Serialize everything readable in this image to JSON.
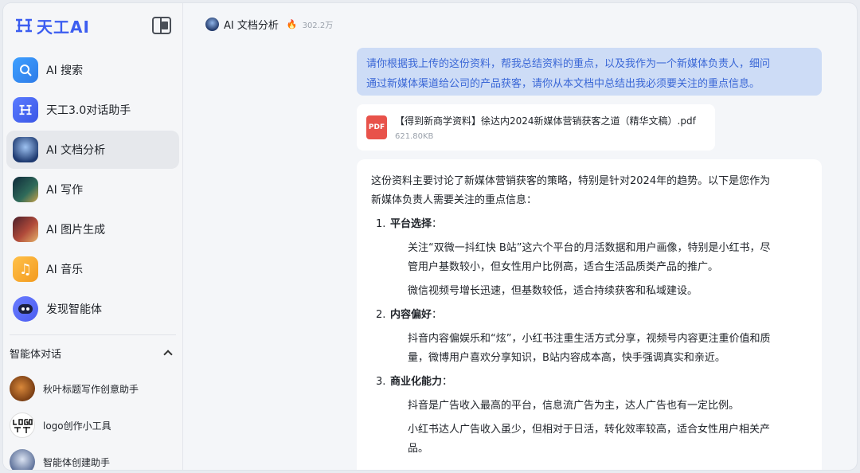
{
  "app": {
    "logo_text": "天工AI"
  },
  "nav": [
    {
      "label": "AI 搜索",
      "icon": "search-icon"
    },
    {
      "label": "天工3.0对话助手",
      "icon": "tiangong-logo-icon"
    },
    {
      "label": "AI 文档分析",
      "icon": "robot-doc-icon",
      "active": true
    },
    {
      "label": "AI 写作",
      "icon": "writing-icon"
    },
    {
      "label": "AI 图片生成",
      "icon": "dragon-image-icon"
    },
    {
      "label": "AI 音乐",
      "icon": "music-note-icon"
    },
    {
      "label": "发现智能体",
      "icon": "agent-bot-icon"
    }
  ],
  "agents_section": {
    "title": "智能体对话"
  },
  "agents": [
    {
      "label": "秋叶标题写作创意助手"
    },
    {
      "label": "logo创作小工具"
    },
    {
      "label": "智能体创建助手"
    }
  ],
  "topbar": {
    "title": "AI 文档分析",
    "count": "302.2万"
  },
  "chat": {
    "user_message_line1": "请你根据我上传的这份资料，帮我总结资料的重点，以及我作为一个新媒体负责人，细问",
    "user_message_line2": "通过新媒体渠道给公司的产品获客，请你从本文档中总结出我必须要关注的重点信息。",
    "file": {
      "icon_text": "PDF",
      "name": "【得到新商学资料】徐达内2024新媒体营销获客之道（精华文稿）.pdf",
      "size": "621.80KB"
    },
    "answer": {
      "intro_line1": "这份资料主要讨论了新媒体营销获客的策略，特别是针对2024年的趋势。以下是您作为",
      "intro_line2": "新媒体负责人需要关注的重点信息：",
      "items": [
        {
          "num": "1.",
          "title": "平台选择",
          "points": [
            [
              "关注“双微一抖红快 B站”这六个平台的月活数据和用户画像，特别是小红书，尽",
              "管用户基数较小，但女性用户比例高，适合生活品质类产品的推广。"
            ],
            [
              "微信视频号增长迅速，但基数较低，适合持续获客和私域建设。"
            ]
          ]
        },
        {
          "num": "2.",
          "title": "内容偏好",
          "points": [
            [
              "抖音内容偏娱乐和“炫”，小红书注重生活方式分享，视频号内容更注重价值和质",
              "量，微博用户喜欢分享知识，B站内容成本高，快手强调真实和亲近。"
            ]
          ]
        },
        {
          "num": "3.",
          "title": "商业化能力",
          "points": [
            [
              "抖音是广告收入最高的平台，信息流广告为主，达人广告也有一定比例。"
            ],
            [
              "小红书达人广告收入虽少，但相对于日活，转化效率较高，适合女性用户相关产",
              "品。"
            ]
          ]
        }
      ],
      "colon": "："
    }
  }
}
